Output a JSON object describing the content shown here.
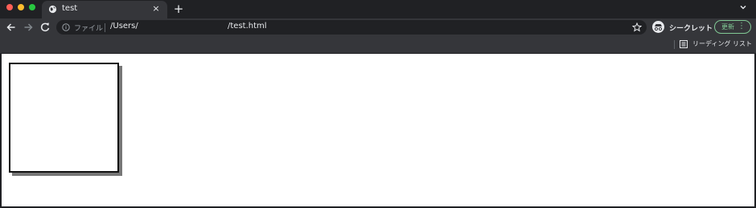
{
  "tab": {
    "title": "test",
    "favicon": "globe-icon",
    "close": "×",
    "new_tab": "+"
  },
  "toolbar": {
    "scheme_label": "ファイル",
    "url_part1": "/Users/",
    "url_part2": "/test.html",
    "incognito_label": "シークレット",
    "update_label": "更新",
    "update_menu": "⋮"
  },
  "bookmarks": {
    "reading_list_label": "リーディング リスト"
  },
  "colors": {
    "traffic_close": "#ff5f57",
    "traffic_min": "#febc2e",
    "traffic_max": "#28c840",
    "update_accent": "#81c995"
  }
}
